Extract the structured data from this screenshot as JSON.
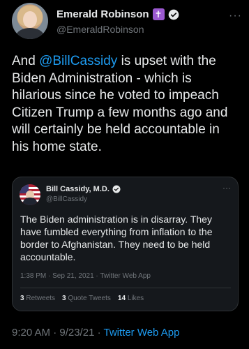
{
  "author": {
    "display_name": "Emerald Robinson",
    "badge_glyph": "✝",
    "handle": "@EmeraldRobinson",
    "more_glyph": "···"
  },
  "tweet": {
    "text_before": "And ",
    "mention": "@BillCassidy",
    "text_after": " is upset with the Biden Administration - which is hilarious since he voted to impeach Citizen Trump a few months ago and will certainly be held accountable in his home state."
  },
  "quote": {
    "display_name": "Bill Cassidy, M.D.",
    "handle": "@BillCassidy",
    "more_glyph": "···",
    "text": "The Biden administration is in disarray. They have fumbled everything from inflation to the border to Afghanistan. They need to be held accountable.",
    "meta": "1:38 PM · Sep 21, 2021 · Twitter Web App",
    "retweets_count": "3",
    "retweets_label": "Retweets",
    "quotes_count": "3",
    "quotes_label": "Quote Tweets",
    "likes_count": "14",
    "likes_label": "Likes"
  },
  "footer": {
    "time_date": "9:20 AM · 9/23/21 · ",
    "app": "Twitter Web App"
  },
  "colors": {
    "background": "#000000",
    "accent": "#1d9bf0",
    "muted": "#71767b",
    "badge": "#9b59d0"
  }
}
